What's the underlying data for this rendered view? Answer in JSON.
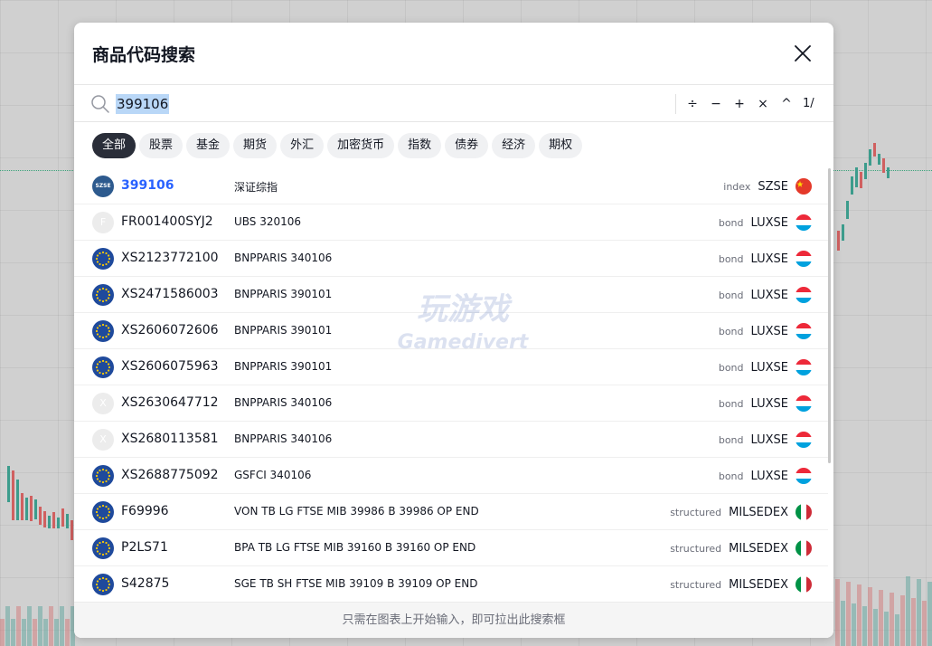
{
  "dialog": {
    "title": "商品代码搜索",
    "search_value": "399106",
    "calc_buttons": [
      "÷",
      "−",
      "+",
      "×",
      "^"
    ],
    "page_indicator": "1/",
    "footer_hint": "只需在图表上开始输入，即可拉出此搜索框"
  },
  "filters": [
    {
      "label": "全部",
      "active": true
    },
    {
      "label": "股票",
      "active": false
    },
    {
      "label": "基金",
      "active": false
    },
    {
      "label": "期货",
      "active": false
    },
    {
      "label": "外汇",
      "active": false
    },
    {
      "label": "加密货币",
      "active": false
    },
    {
      "label": "指数",
      "active": false
    },
    {
      "label": "债券",
      "active": false
    },
    {
      "label": "经济",
      "active": false
    },
    {
      "label": "期权",
      "active": false
    }
  ],
  "results": [
    {
      "symbol": "399106",
      "description": "深证综指",
      "type": "index",
      "exchange": "SZSE",
      "flag": "cn",
      "logo": "szse",
      "logo_text": "SZSE",
      "highlight": true
    },
    {
      "symbol": "FR001400SYJ2",
      "description": "UBS 320106",
      "type": "bond",
      "exchange": "LUXSE",
      "flag": "lu",
      "logo": "letter",
      "logo_text": "F",
      "highlight": false
    },
    {
      "symbol": "XS2123772100",
      "description": "BNPPARIS 340106",
      "type": "bond",
      "exchange": "LUXSE",
      "flag": "lu",
      "logo": "eu",
      "logo_text": "",
      "highlight": false
    },
    {
      "symbol": "XS2471586003",
      "description": "BNPPARIS 390101",
      "type": "bond",
      "exchange": "LUXSE",
      "flag": "lu",
      "logo": "eu",
      "logo_text": "",
      "highlight": false
    },
    {
      "symbol": "XS2606072606",
      "description": "BNPPARIS 390101",
      "type": "bond",
      "exchange": "LUXSE",
      "flag": "lu",
      "logo": "eu",
      "logo_text": "",
      "highlight": false
    },
    {
      "symbol": "XS2606075963",
      "description": "BNPPARIS 390101",
      "type": "bond",
      "exchange": "LUXSE",
      "flag": "lu",
      "logo": "eu",
      "logo_text": "",
      "highlight": false
    },
    {
      "symbol": "XS2630647712",
      "description": "BNPPARIS 340106",
      "type": "bond",
      "exchange": "LUXSE",
      "flag": "lu",
      "logo": "letter",
      "logo_text": "X",
      "highlight": false
    },
    {
      "symbol": "XS2680113581",
      "description": "BNPPARIS 340106",
      "type": "bond",
      "exchange": "LUXSE",
      "flag": "lu",
      "logo": "letter",
      "logo_text": "X",
      "highlight": false
    },
    {
      "symbol": "XS2688775092",
      "description": "GSFCI 340106",
      "type": "bond",
      "exchange": "LUXSE",
      "flag": "lu",
      "logo": "eu",
      "logo_text": "",
      "highlight": false
    },
    {
      "symbol": "F69996",
      "description": "VON TB LG FTSE MIB 39986 B 39986 OP END",
      "type": "structured",
      "exchange": "MILSEDEX",
      "flag": "it",
      "logo": "eu",
      "logo_text": "",
      "highlight": false
    },
    {
      "symbol": "P2LS71",
      "description": "BPA TB LG FTSE MIB 39160 B 39160 OP END",
      "type": "structured",
      "exchange": "MILSEDEX",
      "flag": "it",
      "logo": "eu",
      "logo_text": "",
      "highlight": false
    },
    {
      "symbol": "S42875",
      "description": "SGE TB SH FTSE MIB 39109 B 39109 OP END",
      "type": "structured",
      "exchange": "MILSEDEX",
      "flag": "it",
      "logo": "eu",
      "logo_text": "",
      "highlight": false
    }
  ],
  "watermark": {
    "line1": "玩游戏",
    "line2": "Gamedivert"
  },
  "icons": {
    "close": "close-icon",
    "search": "search-icon",
    "eu_logo": "eu-stars-icon"
  },
  "colors": {
    "highlight_symbol": "#2962ff",
    "chip_active_bg": "#2a2e39",
    "selection": "#b9d7f7"
  }
}
